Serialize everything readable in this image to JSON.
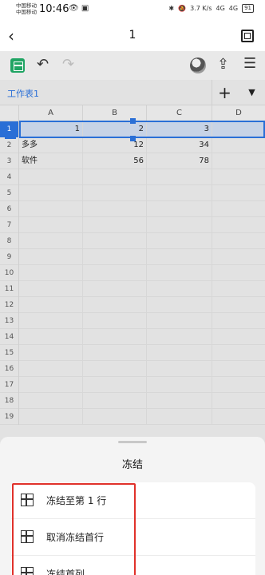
{
  "status": {
    "carrier_1": "中国移动",
    "carrier_2": "中国移动",
    "time": "10:46",
    "net_speed_value": "3.7",
    "net_speed_unit": "K/s",
    "signal_1": "4G",
    "signal_2": "4G",
    "battery": "91"
  },
  "title_bar": {
    "title": "1"
  },
  "sheet_tabs": {
    "active_tab": "工作表1",
    "add_label": "+",
    "dropdown_label": "▼"
  },
  "grid": {
    "columns": [
      "A",
      "B",
      "C",
      "D"
    ],
    "row_numbers": [
      "1",
      "2",
      "3",
      "4",
      "5",
      "6",
      "7",
      "8",
      "9",
      "10",
      "11",
      "12",
      "13",
      "14",
      "15",
      "16",
      "17",
      "18",
      "19"
    ],
    "rows": [
      [
        "1",
        "2",
        "3",
        ""
      ],
      [
        "多多",
        "12",
        "34",
        ""
      ],
      [
        "软件",
        "56",
        "78",
        ""
      ]
    ]
  },
  "freeze_sheet": {
    "title": "冻结",
    "options": [
      "冻结至第 1 行",
      "取消冻结首行",
      "冻结首列"
    ]
  },
  "colors": {
    "accent": "#2a6fd6",
    "highlight": "#e0312a",
    "app_green": "#1fa463"
  },
  "icons": [
    "back-icon",
    "window-icon",
    "sheet-app-icon",
    "undo-icon",
    "redo-icon",
    "share-icon",
    "menu-icon",
    "freeze-icon"
  ]
}
